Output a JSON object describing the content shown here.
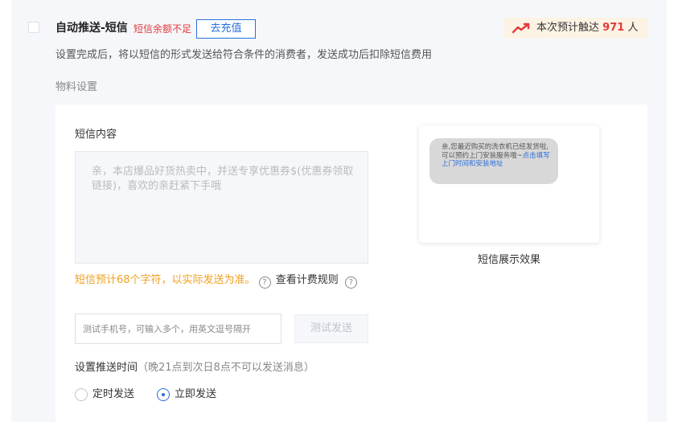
{
  "header": {
    "title": "自动推送-短信",
    "warning": "短信余额不足",
    "recharge_label": "去充值",
    "reach_prefix": "本次预计触达",
    "reach_count": "971",
    "reach_suffix": "人",
    "trend_icon": "trend-line-icon"
  },
  "description": "设置完成后，将以短信的形式发送给符合条件的消费者，发送成功后扣除短信费用",
  "material_section": "物料设置",
  "sms": {
    "label": "短信内容",
    "placeholder": "亲，本店爆品好货热卖中，并送专享优惠券$(优惠券领取链接)，喜欢的亲赶紧下手哦",
    "note": "短信预计68个字符，以实际发送为准。",
    "rule_link": "查看计费规则"
  },
  "test": {
    "phone_placeholder": "测试手机号，可输入多个，用英文逗号隔开",
    "send_label": "测试发送"
  },
  "schedule": {
    "label": "设置推送时间",
    "hint": "（晚21点到次日8点不可以发送消息）",
    "options": [
      {
        "label": "定时发送",
        "selected": false
      },
      {
        "label": "立即发送",
        "selected": true
      }
    ]
  },
  "preview": {
    "message": "亲,您最近购买的洗衣机已经发货啦,可以预约上门安装服务哦~",
    "link_text": "点击填写上门时间和安装地址",
    "caption": "短信展示效果"
  },
  "colors": {
    "accent": "#2a6fdb",
    "warning": "#e4393c",
    "note": "#f0a020"
  }
}
